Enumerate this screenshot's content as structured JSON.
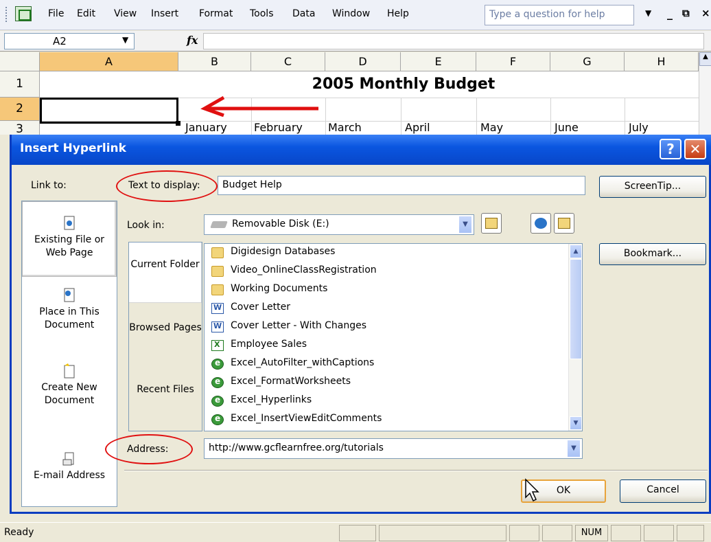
{
  "menu": {
    "items": [
      "File",
      "Edit",
      "View",
      "Insert",
      "Format",
      "Tools",
      "Data",
      "Window",
      "Help"
    ],
    "help_placeholder": "Type a question for help"
  },
  "formula_bar": {
    "name_box": "A2",
    "fx": "fx"
  },
  "grid": {
    "columns": [
      "A",
      "B",
      "C",
      "D",
      "E",
      "F",
      "G",
      "H"
    ],
    "rows": [
      "1",
      "2",
      "3"
    ],
    "title": "2005 Monthly Budget",
    "months": [
      "January",
      "February",
      "March",
      "April",
      "May",
      "June",
      "July"
    ]
  },
  "dialog": {
    "title": "Insert Hyperlink",
    "link_to_label": "Link to:",
    "places": [
      {
        "label": "Existing File or Web Page",
        "selected": true
      },
      {
        "label": "Place in This Document",
        "selected": false
      },
      {
        "label": "Create New Document",
        "selected": false
      },
      {
        "label": "E-mail Address",
        "selected": false
      }
    ],
    "text_to_display_label": "Text to display:",
    "text_to_display_value": "Budget Help",
    "screentip_button": "ScreenTip...",
    "look_in_label": "Look in:",
    "look_in_value": "Removable Disk (E:)",
    "nav": [
      {
        "label": "Current Folder",
        "selected": true
      },
      {
        "label": "Browsed Pages",
        "selected": false
      },
      {
        "label": "Recent Files",
        "selected": false
      }
    ],
    "files": [
      {
        "name": "Digidesign Databases",
        "icon": "folder-icon"
      },
      {
        "name": "Video_OnlineClassRegistration",
        "icon": "folder-icon"
      },
      {
        "name": "Working Documents",
        "icon": "folder-icon"
      },
      {
        "name": "Cover Letter",
        "icon": "word-doc-icon"
      },
      {
        "name": "Cover Letter - With Changes",
        "icon": "word-doc-icon"
      },
      {
        "name": "Employee Sales",
        "icon": "excel-doc-icon"
      },
      {
        "name": "Excel_AutoFilter_withCaptions",
        "icon": "web-page-icon"
      },
      {
        "name": "Excel_FormatWorksheets",
        "icon": "web-page-icon"
      },
      {
        "name": "Excel_Hyperlinks",
        "icon": "web-page-icon"
      },
      {
        "name": "Excel_InsertViewEditComments",
        "icon": "web-page-icon"
      }
    ],
    "bookmark_button": "Bookmark...",
    "address_label": "Address:",
    "address_value": "http://www.gcflearnfree.org/tutorials",
    "ok_button": "OK",
    "cancel_button": "Cancel"
  },
  "status": {
    "ready": "Ready",
    "num": "NUM"
  },
  "colors": {
    "annotation_red": "#e01010",
    "titlebar_blue": "#0a56e0",
    "selected_header": "#f6c779"
  }
}
